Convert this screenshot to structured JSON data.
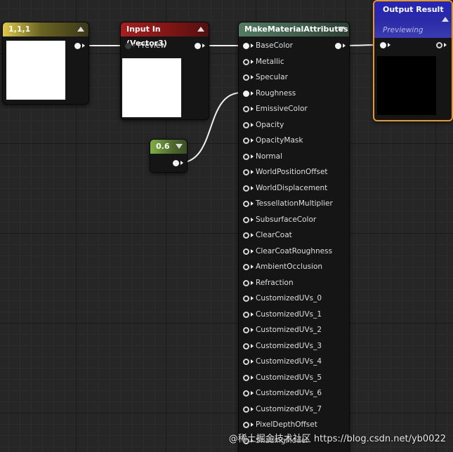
{
  "nodes": {
    "constant3": {
      "title": "1,1,1",
      "color": "#ffffff"
    },
    "input": {
      "title": "Input In (Vector3)",
      "preview_label": "Preview",
      "color": "#ffffff"
    },
    "scalar": {
      "title": "0.6"
    },
    "make_material": {
      "title": "MakeMaterialAttributes",
      "pins": [
        "BaseColor",
        "Metallic",
        "Specular",
        "Roughness",
        "EmissiveColor",
        "Opacity",
        "OpacityMask",
        "Normal",
        "WorldPositionOffset",
        "WorldDisplacement",
        "TessellationMultiplier",
        "SubsurfaceColor",
        "ClearCoat",
        "ClearCoatRoughness",
        "AmbientOcclusion",
        "Refraction",
        "CustomizedUVs_0",
        "CustomizedUVs_1",
        "CustomizedUVs_2",
        "CustomizedUVs_3",
        "CustomizedUVs_4",
        "CustomizedUVs_5",
        "CustomizedUVs_6",
        "CustomizedUVs_7",
        "PixelDepthOffset",
        "ShadingModel"
      ],
      "connected_pins": [
        "BaseColor",
        "Roughness"
      ]
    },
    "output": {
      "title": "Output Result",
      "subtitle": "Previewing",
      "color": "#000000"
    }
  },
  "colors": {
    "constant3_header": "#5c5a1f",
    "input_header": "#9b1b1b",
    "scalar_header": "#4f6a2d",
    "make_material_header": "#3f5b4b",
    "output_header": "#2a2ab0",
    "output_border": "#e89a1c"
  },
  "watermark": "@稀土掘金技术社区 https://blog.csdn.net/yb0022"
}
